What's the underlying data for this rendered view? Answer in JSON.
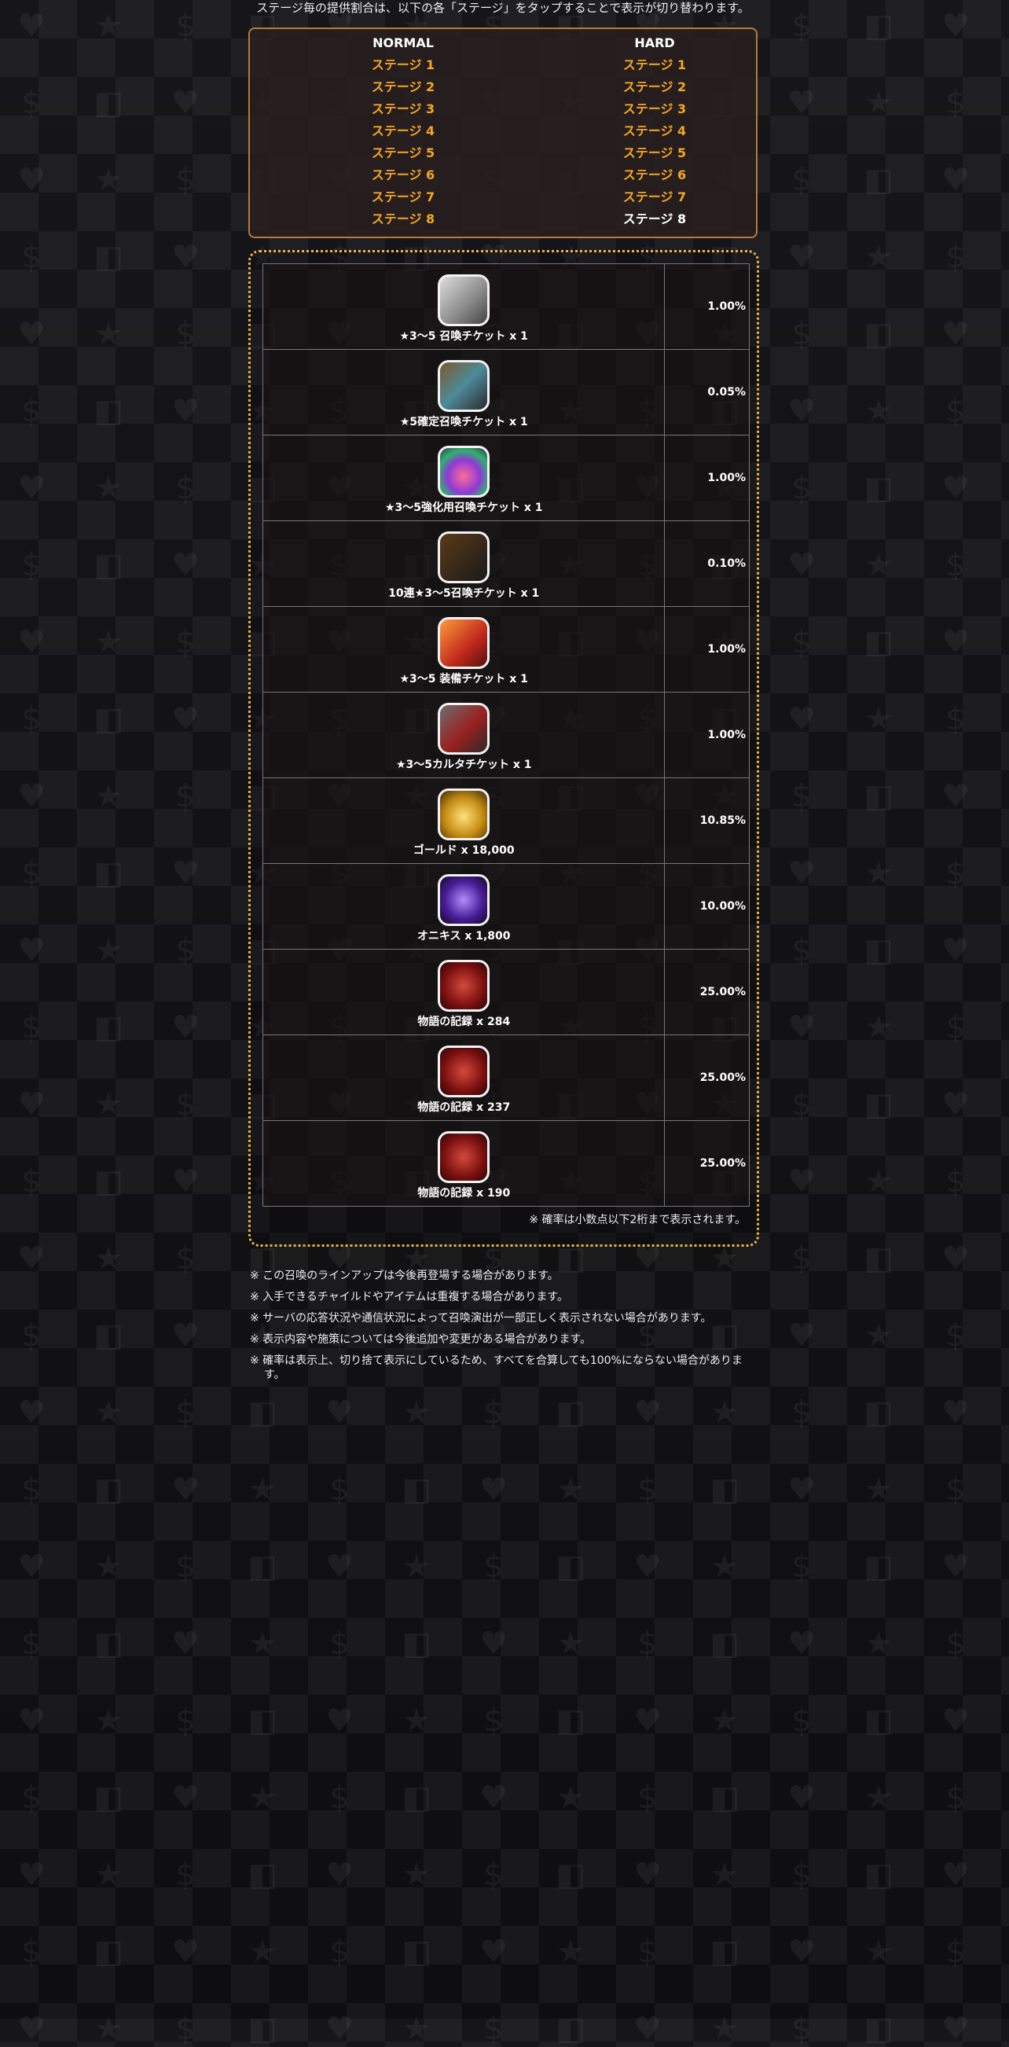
{
  "intro": "ステージ毎の提供割合は、以下の各「ステージ」をタップすることで表示が切り替わります。",
  "stages": {
    "normal": {
      "header": "NORMAL",
      "items": [
        "ステージ 1",
        "ステージ 2",
        "ステージ 3",
        "ステージ 4",
        "ステージ 5",
        "ステージ 6",
        "ステージ 7",
        "ステージ 8"
      ]
    },
    "hard": {
      "header": "HARD",
      "items": [
        "ステージ 1",
        "ステージ 2",
        "ステージ 3",
        "ステージ 4",
        "ステージ 5",
        "ステージ 6",
        "ステージ 7",
        "ステージ 8"
      ],
      "selected": "ステージ 8"
    }
  },
  "colors": {
    "link": "#f5a623",
    "selected": "#ffffff",
    "stage_border": "#b57a3b",
    "rate_border": "#e8b24a"
  },
  "rates": [
    {
      "name": "★3～5 召喚チケット x 1",
      "rate": "1.00%",
      "icon": "summon-ticket-icon"
    },
    {
      "name": "★5確定召喚チケット x 1",
      "rate": "0.05%",
      "icon": "star5-summon-ticket-icon"
    },
    {
      "name": "★3～5強化用召喚チケット x 1",
      "rate": "1.00%",
      "icon": "enhance-summon-ticket-icon"
    },
    {
      "name": "10連★3～5召喚チケット x 1",
      "rate": "0.10%",
      "icon": "ten-summon-ticket-icon"
    },
    {
      "name": "★3～5 装備チケット x 1",
      "rate": "1.00%",
      "icon": "equipment-ticket-icon"
    },
    {
      "name": "★3～5カルタチケット x 1",
      "rate": "1.00%",
      "icon": "karuta-ticket-icon"
    },
    {
      "name": "ゴールド x 18,000",
      "rate": "10.85%",
      "icon": "gold-coins-icon"
    },
    {
      "name": "オニキス x 1,800",
      "rate": "10.00%",
      "icon": "onyx-gem-icon"
    },
    {
      "name": "物語の記録 x 284",
      "rate": "25.00%",
      "icon": "story-record-icon"
    },
    {
      "name": "物語の記録 x 237",
      "rate": "25.00%",
      "icon": "story-record-icon"
    },
    {
      "name": "物語の記録 x 190",
      "rate": "25.00%",
      "icon": "story-record-icon"
    }
  ],
  "decimal_note": "※ 確率は小数点以下2桁まで表示されます。",
  "notes": [
    "※ この召喚のラインアップは今後再登場する場合があります。",
    "※ 入手できるチャイルドやアイテムは重複する場合があります。",
    "※ サーバの応答状況や通信状況によって召喚演出が一部正しく表示されない場合があります。",
    "※ 表示内容や施策については今後追加や変更がある場合があります。",
    "※ 確率は表示上、切り捨て表示にしているため、すべてを合算しても100%にならない場合があります。"
  ]
}
